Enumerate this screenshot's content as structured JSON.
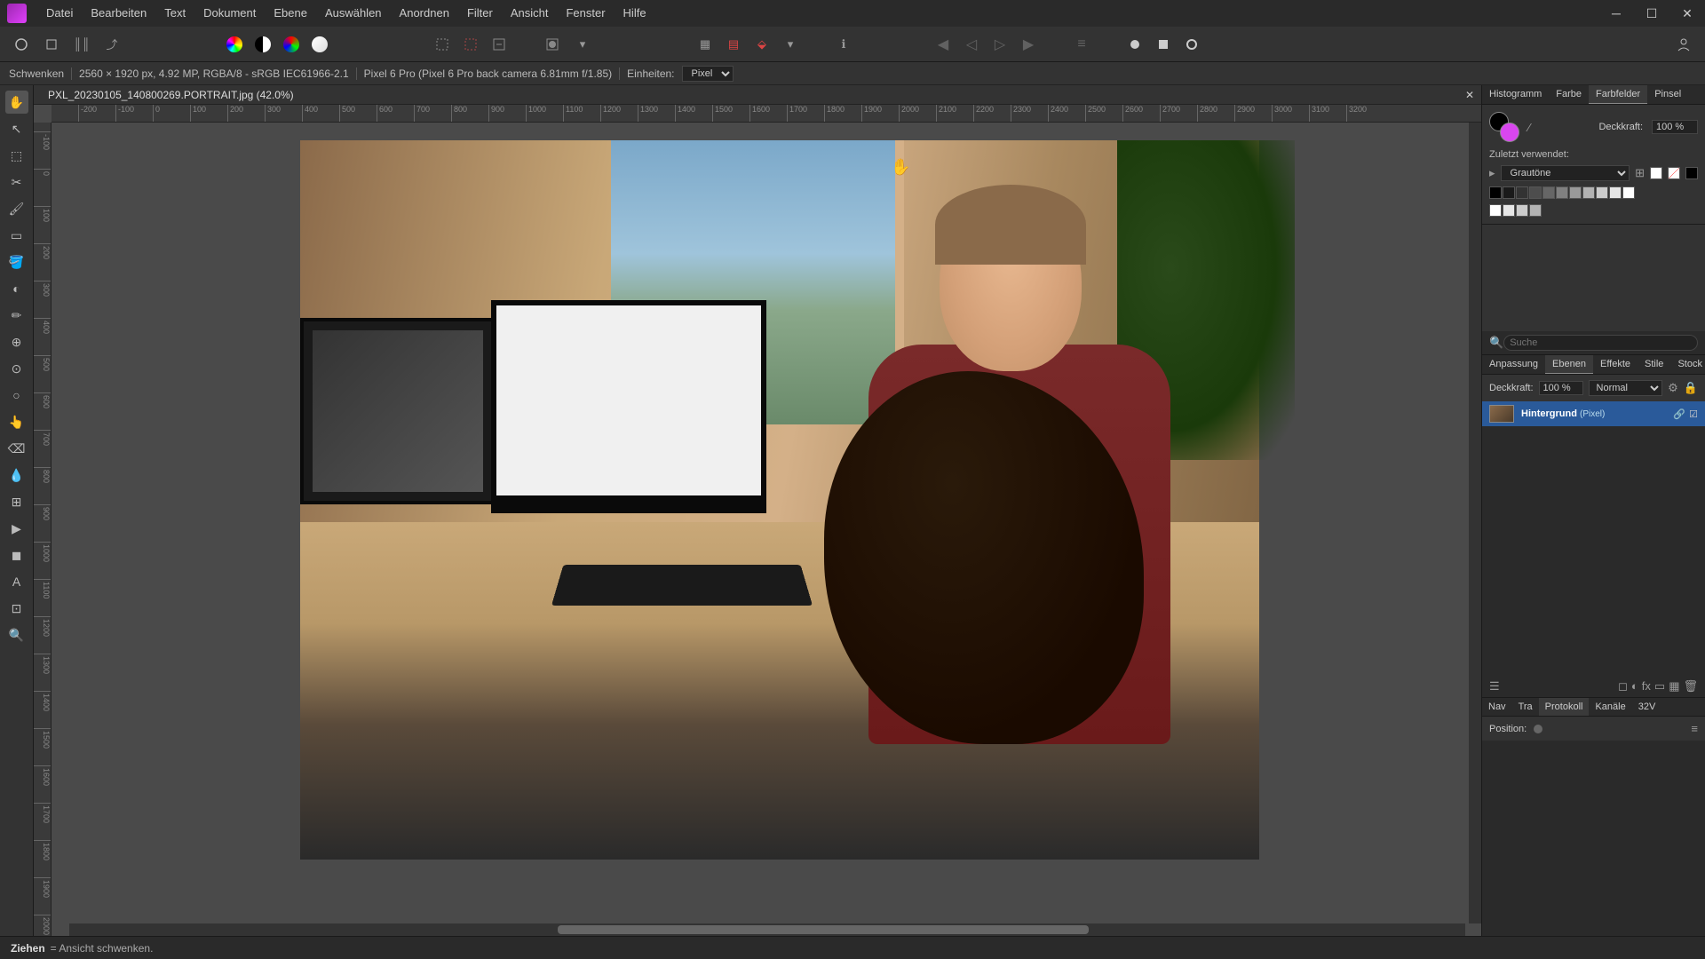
{
  "menu": [
    "Datei",
    "Bearbeiten",
    "Text",
    "Dokument",
    "Ebene",
    "Auswählen",
    "Anordnen",
    "Filter",
    "Ansicht",
    "Fenster",
    "Hilfe"
  ],
  "context": {
    "tool": "Schwenken",
    "dims": "2560 × 1920 px, 4.92 MP, RGBA/8 - sRGB IEC61966-2.1",
    "camera": "Pixel 6 Pro (Pixel 6 Pro back camera 6.81mm f/1.85)",
    "units_label": "Einheiten:",
    "units_value": "Pixel"
  },
  "doc_tab": "PXL_20230105_140800269.PORTRAIT.jpg (42.0%)",
  "ruler_ticks": [
    "-200",
    "-100",
    "0",
    "100",
    "200",
    "300",
    "400",
    "500",
    "600",
    "700",
    "800",
    "900",
    "1000",
    "1100",
    "1200",
    "1300",
    "1400",
    "1500",
    "1600",
    "1700",
    "1800",
    "1900",
    "2000",
    "2100",
    "2200",
    "2300",
    "2400",
    "2500",
    "2600",
    "2700",
    "2800",
    "2900",
    "3000",
    "3100",
    "3200"
  ],
  "vruler_ticks": [
    "-100",
    "0",
    "100",
    "200",
    "300",
    "400",
    "500",
    "600",
    "700",
    "800",
    "900",
    "1000",
    "1100",
    "1200",
    "1300",
    "1400",
    "1500",
    "1600",
    "1700",
    "1800",
    "1900",
    "2000"
  ],
  "right": {
    "tabs1": [
      "Histogramm",
      "Farbe",
      "Farbfelder",
      "Pinsel"
    ],
    "tabs1_active": 2,
    "opacity_label": "Deckkraft:",
    "opacity_value": "100 %",
    "recent_label": "Zuletzt verwendet:",
    "palette_name": "Grautöne",
    "search_placeholder": "Suche",
    "tabs2": [
      "Anpassung",
      "Ebenen",
      "Effekte",
      "Stile",
      "Stock"
    ],
    "tabs2_active": 1,
    "layer_opacity_label": "Deckkraft:",
    "layer_opacity": "100 %",
    "blend_mode": "Normal",
    "layer_name": "Hintergrund",
    "layer_type": "(Pixel)",
    "tabs3": [
      "Nav",
      "Tra",
      "Protokoll",
      "Kanäle",
      "32V"
    ],
    "tabs3_active": 2,
    "position_label": "Position:"
  },
  "status": {
    "action": "Ziehen",
    "hint": "= Ansicht schwenken."
  },
  "grayscale": [
    "#000",
    "#1a1a1a",
    "#333",
    "#4d4d4d",
    "#666",
    "#808080",
    "#999",
    "#b3b3b3",
    "#ccc",
    "#e6e6e6",
    "#fff"
  ],
  "grayscale2": [
    "#fff",
    "#e6e6e6",
    "#ccc",
    "#b3b3b3"
  ]
}
